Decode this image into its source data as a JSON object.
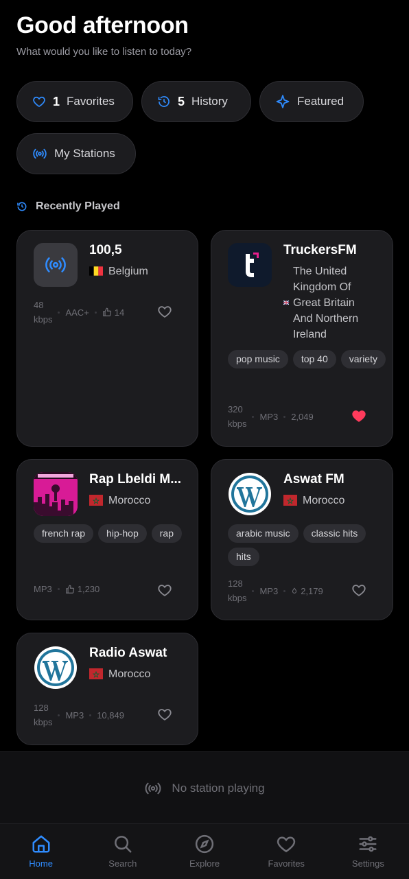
{
  "header": {
    "greeting": "Good afternoon",
    "subtitle": "What would you like to listen to today?"
  },
  "chips": {
    "favorites": {
      "count": "1",
      "label": "Favorites"
    },
    "history": {
      "count": "5",
      "label": "History"
    },
    "featured": {
      "label": "Featured"
    },
    "my_stations": {
      "label": "My Stations"
    }
  },
  "recently_played": {
    "title": "Recently Played",
    "stations": [
      {
        "name": "100,5",
        "country": "Belgium",
        "bitrate": "48",
        "bitrate_unit": "kbps",
        "codec": "AAC+",
        "votes": "14",
        "favorited": false,
        "icon": "radio-waves-icon"
      },
      {
        "name": "TruckersFM",
        "country": "The United Kingdom Of Great Britain And Northern Ireland",
        "country_lines": [
          "The United",
          "Kingdom Of",
          "Great Britain",
          "And Northern",
          "Ireland"
        ],
        "tags": [
          "pop music",
          "top 40",
          "variety"
        ],
        "bitrate": "320",
        "bitrate_unit": "kbps",
        "codec": "MP3",
        "votes": "2,049",
        "favorited": true,
        "icon": "truckersfm-logo"
      },
      {
        "name": "Rap Lbeldi M...",
        "country": "Morocco",
        "tags": [
          "french rap",
          "hip-hop",
          "rap"
        ],
        "codec": "MP3",
        "votes": "1,230",
        "favorited": false,
        "icon": "rap-lbeldi-logo"
      },
      {
        "name": "Aswat FM",
        "country": "Morocco",
        "tags": [
          "arabic music",
          "classic hits",
          "hits"
        ],
        "bitrate": "128",
        "bitrate_unit": "kbps",
        "codec": "MP3",
        "votes": "2,179",
        "favorited": false,
        "icon": "wordpress-logo"
      },
      {
        "name": "Radio Aswat",
        "country": "Morocco",
        "bitrate": "128",
        "bitrate_unit": "kbps",
        "codec": "MP3",
        "votes": "10,849",
        "favorited": false,
        "icon": "wordpress-logo"
      }
    ]
  },
  "player": {
    "status": "No station playing"
  },
  "nav": {
    "items": [
      {
        "label": "Home",
        "icon": "home-icon",
        "active": true
      },
      {
        "label": "Search",
        "icon": "search-icon",
        "active": false
      },
      {
        "label": "Explore",
        "icon": "compass-icon",
        "active": false
      },
      {
        "label": "Favorites",
        "icon": "heart-icon",
        "active": false
      },
      {
        "label": "Settings",
        "icon": "sliders-icon",
        "active": false
      }
    ]
  },
  "colors": {
    "accent": "#2f8cff",
    "favorite": "#ff3b5c",
    "background": "#000000",
    "card": "#1c1c1f"
  }
}
